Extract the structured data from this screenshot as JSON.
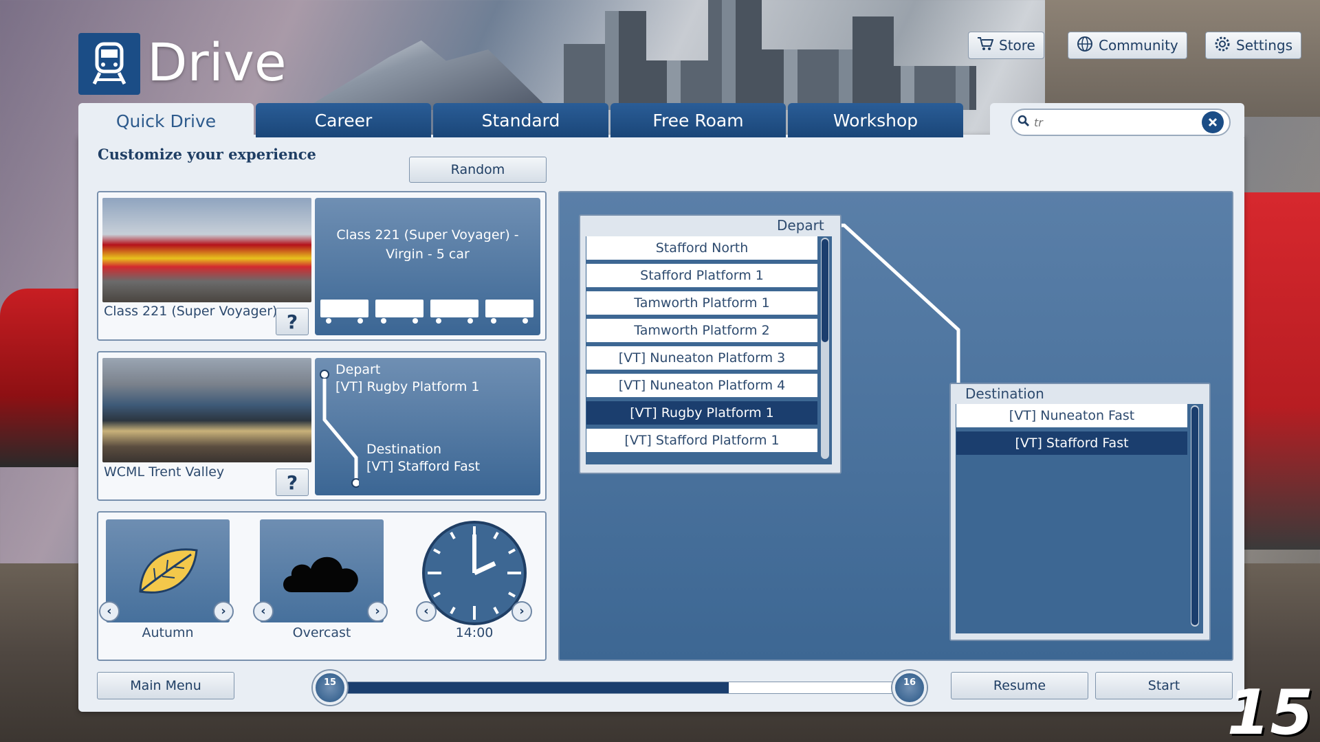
{
  "app": {
    "title": "Drive",
    "logo_icon": "train-icon"
  },
  "top_buttons": {
    "store": "Store",
    "community": "Community",
    "settings": "Settings"
  },
  "tabs": [
    {
      "label": "Quick Drive",
      "active": true
    },
    {
      "label": "Career",
      "active": false
    },
    {
      "label": "Standard",
      "active": false
    },
    {
      "label": "Free Roam",
      "active": false
    },
    {
      "label": "Workshop",
      "active": false
    }
  ],
  "search": {
    "value": "",
    "placeholder": "tr"
  },
  "subtitle": "Customize your experience",
  "random_button": "Random",
  "train": {
    "name": "Class 221 (Super Voyager)",
    "detail": "Class 221 (Super Voyager) - Virgin - 5 car",
    "help": "?"
  },
  "route": {
    "name": "WCML Trent Valley",
    "help": "?",
    "depart_label": "Depart",
    "depart_value": "[VT] Rugby Platform 1",
    "destination_label": "Destination",
    "destination_value": "[VT] Stafford Fast"
  },
  "environment": {
    "season": "Autumn",
    "weather": "Overcast",
    "time": "14:00"
  },
  "depart_list": {
    "header": "Depart",
    "items": [
      "Stafford North",
      "Stafford Platform 1",
      "Tamworth Platform 1",
      "Tamworth Platform 2",
      "[VT] Nuneaton Platform 3",
      "[VT] Nuneaton Platform 4",
      "[VT] Rugby Platform 1",
      "[VT] Stafford Platform 1"
    ],
    "selected_index": 6
  },
  "destination_list": {
    "header": "Destination",
    "items": [
      "[VT] Nuneaton Fast",
      "[VT] Stafford Fast"
    ],
    "selected_index": 1
  },
  "footer": {
    "main_menu": "Main Menu",
    "resume": "Resume",
    "start": "Start"
  },
  "progress": {
    "min_label": "15",
    "max_label": "16",
    "fill_fraction": 0.7
  },
  "game_number": "15",
  "colors": {
    "accent_blue": "#1b4d86",
    "selected_row": "#1b3e6e",
    "panel_bg": "#e9eef4"
  }
}
